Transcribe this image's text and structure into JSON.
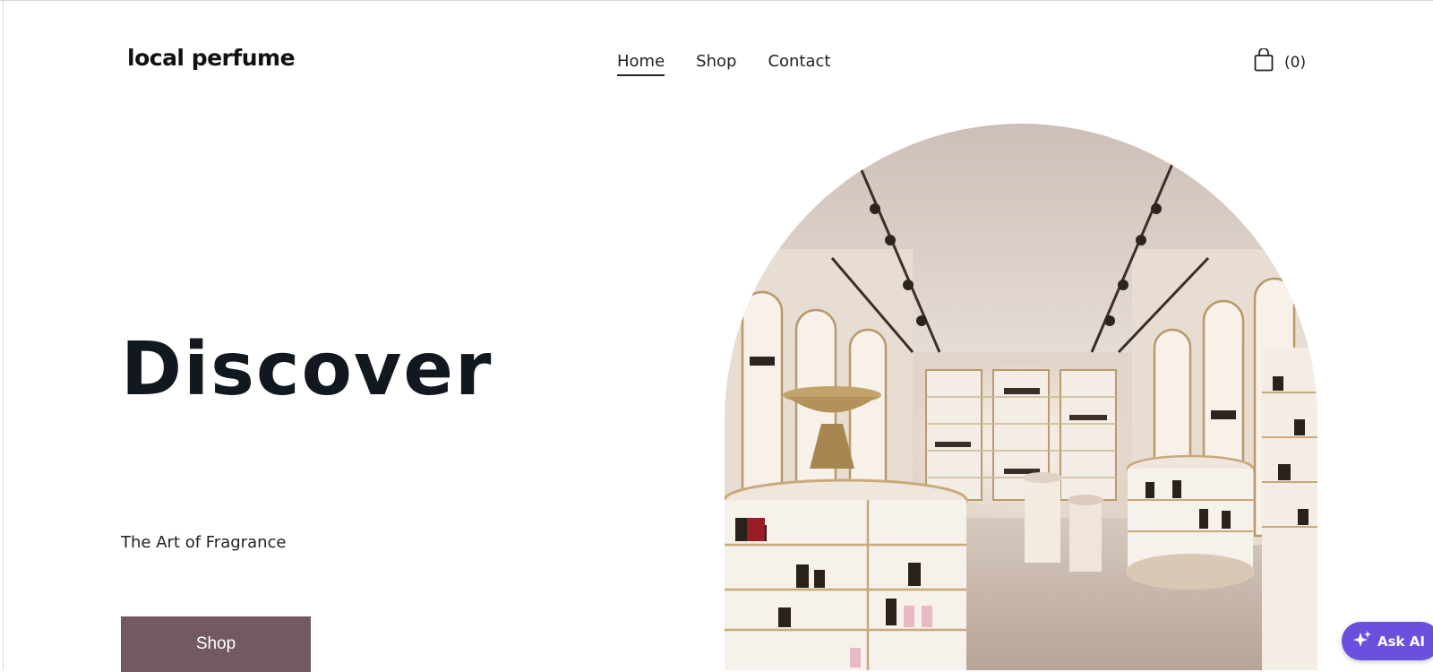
{
  "header": {
    "logo": "local perfume",
    "nav": [
      {
        "label": "Home",
        "active": true
      },
      {
        "label": "Shop",
        "active": false
      },
      {
        "label": "Contact",
        "active": false
      }
    ],
    "cart": {
      "icon": "shopping-bag-icon",
      "count": "(0)"
    }
  },
  "hero": {
    "title": "Discover",
    "tagline": "The Art of Fragrance",
    "cta_label": "Shop",
    "cta_color": "#735a60",
    "image": "perfume-store-interior"
  },
  "assistant": {
    "label": "Ask AI",
    "icon": "sparkles-icon",
    "color": "#6b4fdd"
  }
}
